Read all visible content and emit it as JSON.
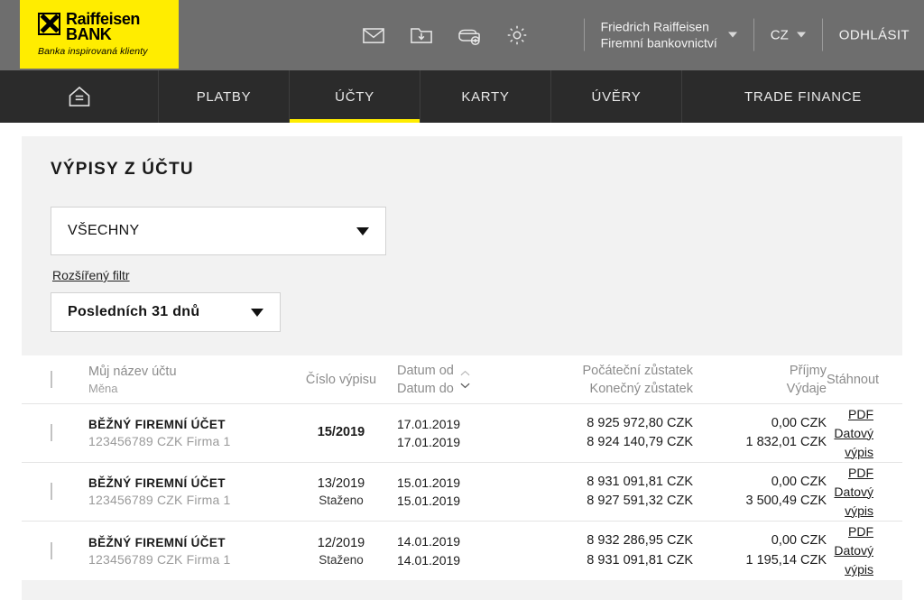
{
  "header": {
    "logo": {
      "name_line1": "Raiffeisen",
      "name_line2": "BANK",
      "tagline": "Banka inspirovaná klienty"
    },
    "icons": [
      {
        "name": "mail-icon",
        "label": "Zprávy"
      },
      {
        "name": "folder-download-icon",
        "label": "Dokumenty ke stažení"
      },
      {
        "name": "wallet-add-icon",
        "label": "Nový produkt"
      },
      {
        "name": "gear-icon",
        "label": "Nastavení"
      }
    ],
    "user": {
      "name": "Friedrich Raiffeisen",
      "role": "Firemní bankovnictví"
    },
    "language": "CZ",
    "logout": "ODHLÁSIT"
  },
  "nav": {
    "home_icon": "home-icon",
    "items": [
      {
        "label": "PLATBY",
        "active": false
      },
      {
        "label": "ÚČTY",
        "active": true
      },
      {
        "label": "KARTY",
        "active": false
      },
      {
        "label": "ÚVĚRY",
        "active": false
      },
      {
        "label": "TRADE FINANCE",
        "active": false
      }
    ]
  },
  "main": {
    "title": "VÝPISY Z ÚČTU",
    "account_filter": {
      "value": "VŠECHNY"
    },
    "advanced_filter_link": "Rozšířený filtr",
    "period_filter": {
      "value": "Posledních 31 dnů"
    },
    "table": {
      "headers": {
        "account_line1": "Můj název účtu",
        "account_line2": "Měna",
        "statement_number": "Číslo výpisu",
        "date_from": "Datum od",
        "date_to": "Datum do",
        "balance_opening": "Počáteční zůstatek",
        "balance_closing": "Konečný zůstatek",
        "income": "Příjmy",
        "expense": "Výdaje",
        "download": "Stáhnout"
      },
      "rows": [
        {
          "account_name": "BĚŽNÝ FIREMNÍ ÚČET",
          "account_sub": "123456789 CZK Firma 1",
          "statement_number": "15/2019",
          "statement_status": "",
          "statement_bold": true,
          "date_from": "17.01.2019",
          "date_to": "17.01.2019",
          "balance_opening": "8 925 972,80 CZK",
          "balance_closing": "8 924 140,79 CZK",
          "income": "0,00 CZK",
          "expense": "1 832,01 CZK",
          "download_pdf": "PDF",
          "download_data": "Datový výpis"
        },
        {
          "account_name": "BĚŽNÝ FIREMNÍ ÚČET",
          "account_sub": "123456789 CZK Firma 1",
          "statement_number": "13/2019",
          "statement_status": "Staženo",
          "statement_bold": false,
          "date_from": "15.01.2019",
          "date_to": "15.01.2019",
          "balance_opening": "8 931 091,81 CZK",
          "balance_closing": "8 927 591,32 CZK",
          "income": "0,00 CZK",
          "expense": "3 500,49 CZK",
          "download_pdf": "PDF",
          "download_data": "Datový výpis"
        },
        {
          "account_name": "BĚŽNÝ FIREMNÍ ÚČET",
          "account_sub": "123456789 CZK Firma 1",
          "statement_number": "12/2019",
          "statement_status": "Staženo",
          "statement_bold": false,
          "date_from": "14.01.2019",
          "date_to": "14.01.2019",
          "balance_opening": "8 932 286,95 CZK",
          "balance_closing": "8 931 091,81 CZK",
          "income": "0,00 CZK",
          "expense": "1 195,14 CZK",
          "download_pdf": "PDF",
          "download_data": "Datový výpis"
        }
      ]
    }
  },
  "colors": {
    "brand_yellow": "#ffed00",
    "header_gray": "#6e6e6e",
    "nav_dark": "#2b2b2b",
    "card_gray": "#f2f2f2"
  }
}
